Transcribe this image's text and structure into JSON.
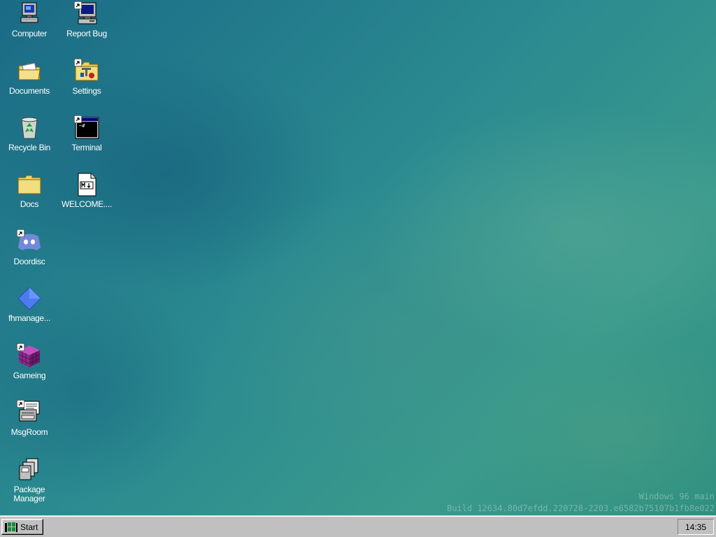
{
  "desktop": {
    "icons": [
      {
        "label": "Computer",
        "icon": "computer-icon",
        "shortcut": false
      },
      {
        "label": "Report Bug",
        "icon": "report-bug-icon",
        "shortcut": true
      },
      {
        "label": "Documents",
        "icon": "documents-folder-icon",
        "shortcut": false
      },
      {
        "label": "Settings",
        "icon": "settings-folder-icon",
        "shortcut": true
      },
      {
        "label": "Recycle Bin",
        "icon": "recycle-bin-icon",
        "shortcut": false
      },
      {
        "label": "Terminal",
        "icon": "terminal-icon",
        "shortcut": true
      },
      {
        "label": "Docs",
        "icon": "folder-icon",
        "shortcut": false
      },
      {
        "label": "WELCOME....",
        "icon": "markdown-file-icon",
        "shortcut": false
      },
      {
        "label": "Doordisc",
        "icon": "doordisc-icon",
        "shortcut": true
      },
      {
        "label": "fhmanage...",
        "icon": "blue-diamond-icon",
        "shortcut": false
      },
      {
        "label": "Gameing",
        "icon": "purple-cube-icon",
        "shortcut": true
      },
      {
        "label": "MsgRoom",
        "icon": "msgroom-icon",
        "shortcut": true
      },
      {
        "label": "Package Manager",
        "icon": "package-manager-icon",
        "shortcut": false
      }
    ],
    "build_info": {
      "line1": "Windows 96 main",
      "line2": "Build 12634.80d7efdd.220728-2203.e6582b75107b1fb8e022"
    }
  },
  "taskbar": {
    "start_label": "Start",
    "clock": "14:35"
  },
  "colors": {
    "desktop_teal": "#2a8a90",
    "taskbar_gray": "#c0c0c0"
  }
}
